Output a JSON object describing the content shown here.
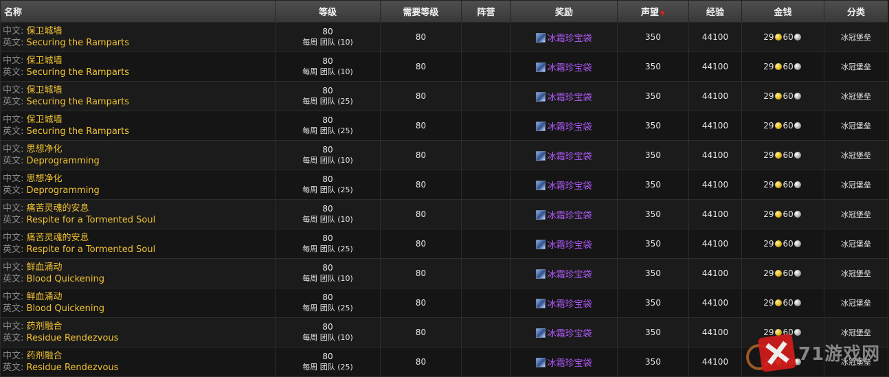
{
  "headers": {
    "name": "名称",
    "level": "等级",
    "req_level": "需要等级",
    "faction": "阵营",
    "reward": "奖励",
    "reputation": "声望",
    "experience": "经验",
    "money": "金钱",
    "category": "分类"
  },
  "name_prefix_cn": "中文:",
  "name_prefix_en": "英文:",
  "rows": [
    {
      "cn": "保卫城墙",
      "en": "Securing the Ramparts",
      "level": "80",
      "level_note": "每周 团队 (10)",
      "req": "80",
      "faction": "",
      "reward": "冰霜珍宝袋",
      "rep": "350",
      "xp": "44100",
      "gold": "29",
      "silver": "60",
      "category": "冰冠堡垒"
    },
    {
      "cn": "保卫城墙",
      "en": "Securing the Ramparts",
      "level": "80",
      "level_note": "每周 团队 (10)",
      "req": "80",
      "faction": "",
      "reward": "冰霜珍宝袋",
      "rep": "350",
      "xp": "44100",
      "gold": "29",
      "silver": "60",
      "category": "冰冠堡垒"
    },
    {
      "cn": "保卫城墙",
      "en": "Securing the Ramparts",
      "level": "80",
      "level_note": "每周 团队 (25)",
      "req": "80",
      "faction": "",
      "reward": "冰霜珍宝袋",
      "rep": "350",
      "xp": "44100",
      "gold": "29",
      "silver": "60",
      "category": "冰冠堡垒"
    },
    {
      "cn": "保卫城墙",
      "en": "Securing the Ramparts",
      "level": "80",
      "level_note": "每周 团队 (25)",
      "req": "80",
      "faction": "",
      "reward": "冰霜珍宝袋",
      "rep": "350",
      "xp": "44100",
      "gold": "29",
      "silver": "60",
      "category": "冰冠堡垒"
    },
    {
      "cn": "思想净化",
      "en": "Deprogramming",
      "level": "80",
      "level_note": "每周 团队 (10)",
      "req": "80",
      "faction": "",
      "reward": "冰霜珍宝袋",
      "rep": "350",
      "xp": "44100",
      "gold": "29",
      "silver": "60",
      "category": "冰冠堡垒"
    },
    {
      "cn": "思想净化",
      "en": "Deprogramming",
      "level": "80",
      "level_note": "每周 团队 (25)",
      "req": "80",
      "faction": "",
      "reward": "冰霜珍宝袋",
      "rep": "350",
      "xp": "44100",
      "gold": "29",
      "silver": "60",
      "category": "冰冠堡垒"
    },
    {
      "cn": "痛苦灵魂的安息",
      "en": "Respite for a Tormented Soul",
      "level": "80",
      "level_note": "每周 团队 (10)",
      "req": "80",
      "faction": "",
      "reward": "冰霜珍宝袋",
      "rep": "350",
      "xp": "44100",
      "gold": "29",
      "silver": "60",
      "category": "冰冠堡垒"
    },
    {
      "cn": "痛苦灵魂的安息",
      "en": "Respite for a Tormented Soul",
      "level": "80",
      "level_note": "每周 团队 (25)",
      "req": "80",
      "faction": "",
      "reward": "冰霜珍宝袋",
      "rep": "350",
      "xp": "44100",
      "gold": "29",
      "silver": "60",
      "category": "冰冠堡垒"
    },
    {
      "cn": "鲜血涌动",
      "en": "Blood Quickening",
      "level": "80",
      "level_note": "每周 团队 (10)",
      "req": "80",
      "faction": "",
      "reward": "冰霜珍宝袋",
      "rep": "350",
      "xp": "44100",
      "gold": "29",
      "silver": "60",
      "category": "冰冠堡垒"
    },
    {
      "cn": "鲜血涌动",
      "en": "Blood Quickening",
      "level": "80",
      "level_note": "每周 团队 (25)",
      "req": "80",
      "faction": "",
      "reward": "冰霜珍宝袋",
      "rep": "350",
      "xp": "44100",
      "gold": "29",
      "silver": "60",
      "category": "冰冠堡垒"
    },
    {
      "cn": "药剂融合",
      "en": "Residue Rendezvous",
      "level": "80",
      "level_note": "每周 团队 (10)",
      "req": "80",
      "faction": "",
      "reward": "冰霜珍宝袋",
      "rep": "350",
      "xp": "44100",
      "gold": "29",
      "silver": "60",
      "category": "冰冠堡垒"
    },
    {
      "cn": "药剂融合",
      "en": "Residue Rendezvous",
      "level": "80",
      "level_note": "每周 团队 (25)",
      "req": "80",
      "faction": "",
      "reward": "冰霜珍宝袋",
      "rep": "350",
      "xp": "44100",
      "gold": "29",
      "silver": "60",
      "category": "冰冠堡垒"
    }
  ],
  "icons": {
    "reward": "frost-treasure-bag-icon",
    "sort": "sort-desc-icon",
    "gold": "gold-coin-icon",
    "silver": "silver-coin-icon"
  },
  "colors": {
    "quest_name": "#f1c232",
    "reward_purple": "#b35bff",
    "sort_arrow": "#e02020"
  },
  "watermark": {
    "text": "71游戏网"
  }
}
